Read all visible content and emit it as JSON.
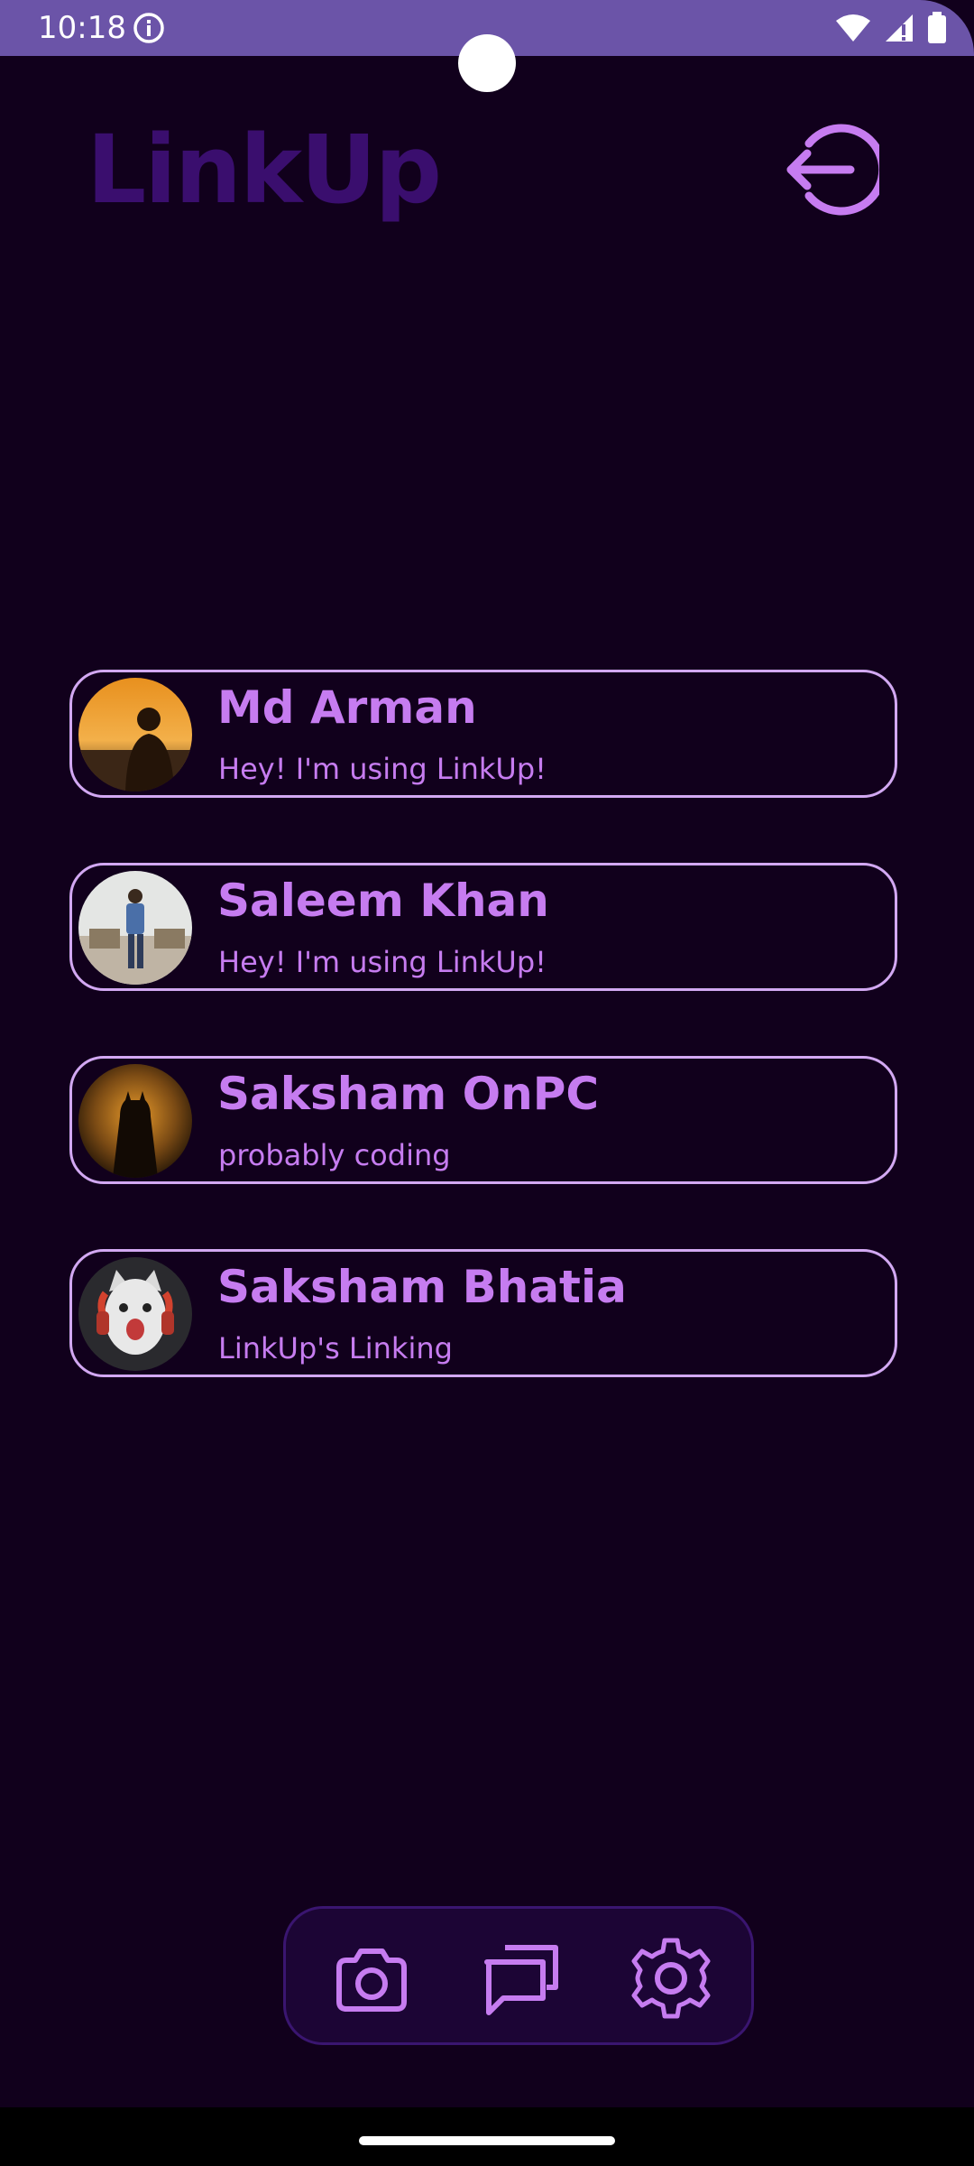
{
  "status_bar": {
    "time": "10:18",
    "icons": [
      "info-icon",
      "wifi-icon",
      "signal-icon",
      "battery-icon"
    ],
    "color": "#6B54A8"
  },
  "header": {
    "title": "LinkUp",
    "title_color": "#3A0E6E",
    "logout_icon": "logout-icon"
  },
  "contacts": [
    {
      "name": "Md Arman",
      "status": "Hey! I'm using LinkUp!"
    },
    {
      "name": "Saleem Khan",
      "status": "Hey! I'm using LinkUp!"
    },
    {
      "name": "Saksham OnPC",
      "status": "probably coding"
    },
    {
      "name": "Saksham Bhatia",
      "status": "LinkUp's Linking"
    }
  ],
  "bottom_nav": {
    "items": [
      "camera-icon",
      "chats-icon",
      "settings-icon"
    ]
  },
  "colors": {
    "background": "#11001C",
    "accent": "#C67CF0",
    "card_border": "#D2A8F2",
    "nav_background": "#1C0535"
  }
}
